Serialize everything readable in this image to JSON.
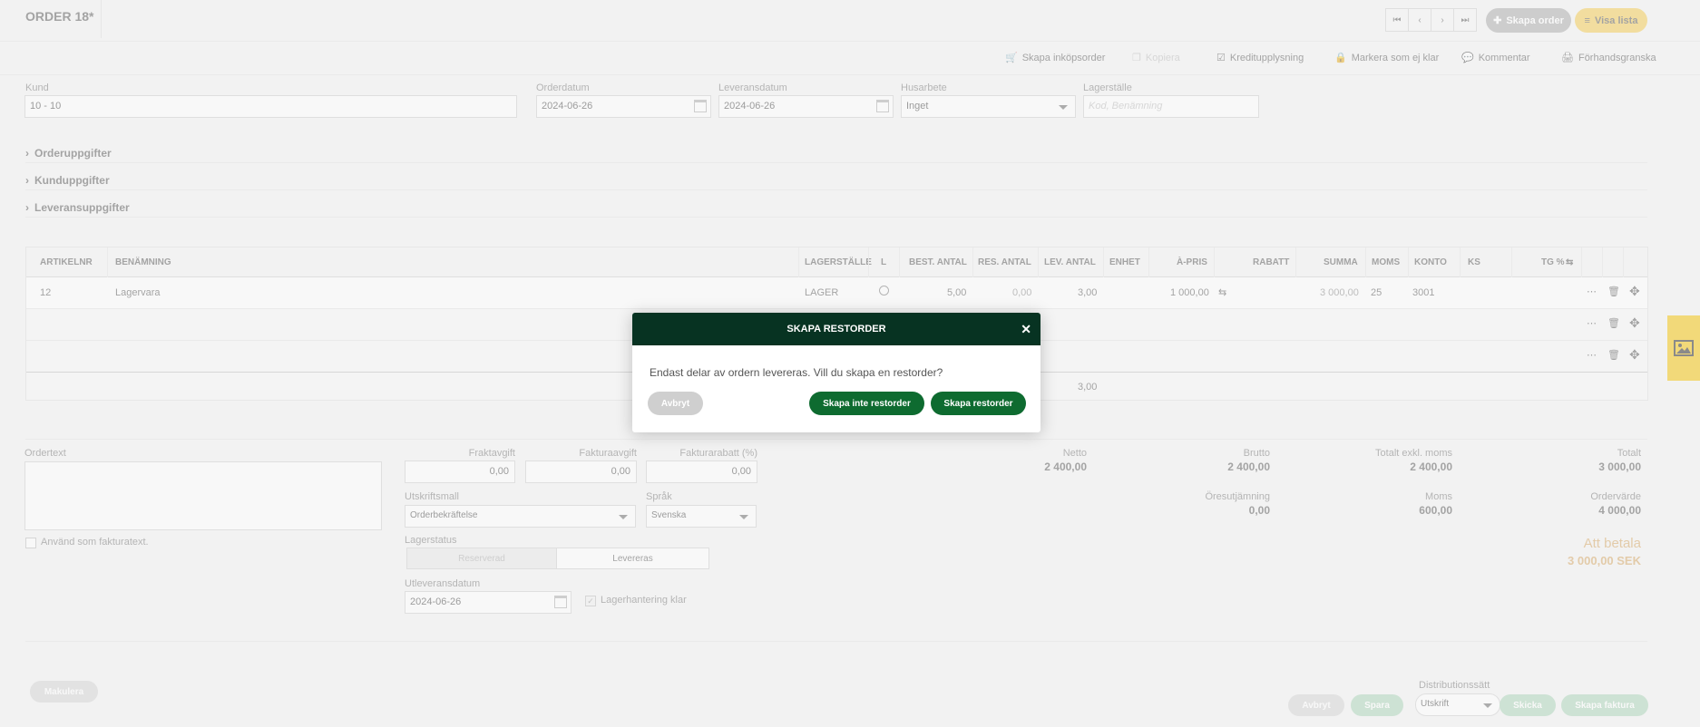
{
  "header": {
    "title": "ORDER 18*",
    "nav": [
      "⏮",
      "‹",
      "›",
      "⏭"
    ],
    "create_order_label": "Skapa order",
    "show_list_label": "Visa lista"
  },
  "toolbar": {
    "items": [
      {
        "label": "Skapa inköpsorder",
        "icon": "cart-icon",
        "disabled": false
      },
      {
        "label": "Kopiera",
        "icon": "copy-icon",
        "disabled": true
      },
      {
        "label": "Kreditupplysning",
        "icon": "check-square-icon",
        "disabled": false
      },
      {
        "label": "Markera som ej klar",
        "icon": "lock-icon",
        "disabled": false
      },
      {
        "label": "Kommentar",
        "icon": "comment-icon",
        "disabled": false
      },
      {
        "label": "Förhandsgranska",
        "icon": "print-icon",
        "disabled": false
      }
    ]
  },
  "form": {
    "customer_label": "Kund",
    "customer_value": "10 - 10",
    "order_date_label": "Orderdatum",
    "order_date_value": "2024-06-26",
    "delivery_date_label": "Leveransdatum",
    "delivery_date_value": "2024-06-26",
    "household_label": "Husarbete",
    "household_value": "Inget",
    "warehouse_label": "Lagerställe",
    "warehouse_placeholder": "Kod, Benämning"
  },
  "sections": [
    "Orderuppgifter",
    "Kunduppgifter",
    "Leveransuppgifter"
  ],
  "table": {
    "headers": [
      "ARTIKELNR",
      "BENÄMNING",
      "LAGERSTÄLLE",
      "L",
      "BEST. ANTAL",
      "RES. ANTAL",
      "LEV. ANTAL",
      "ENHET",
      "À-PRIS",
      "RABATT",
      "SUMMA",
      "MOMS",
      "KONTO",
      "KS",
      "TG %"
    ],
    "rows": [
      {
        "artikelnr": "12",
        "benamning": "Lagervara",
        "lagerstalle": "LAGER",
        "best_antal": "5,00",
        "res_antal": "0,00",
        "lev_antal": "3,00",
        "a_pris": "1 000,00",
        "summa": "3 000,00",
        "moms": "25",
        "konto": "3001"
      }
    ],
    "total_lev_antal": "3,00"
  },
  "bottom": {
    "ordertext_label": "Ordertext",
    "use_as_invoice_text": "Använd som fakturatext.",
    "freight_label": "Fraktavgift",
    "freight_value": "0,00",
    "invoice_fee_label": "Fakturaavgift",
    "invoice_fee_value": "0,00",
    "invoice_discount_label": "Fakturarabatt (%)",
    "invoice_discount_value": "0,00",
    "print_template_label": "Utskriftsmall",
    "print_template_value": "Orderbekräftelse",
    "language_label": "Språk",
    "language_value": "Svenska",
    "stock_status_label": "Lagerstatus",
    "stock_status_reserved": "Reserverad",
    "stock_status_deliver": "Levereras",
    "delivery_out_label": "Utleveransdatum",
    "delivery_out_value": "2024-06-26",
    "stock_handling_label": "Lagerhantering klar"
  },
  "summary": {
    "netto_label": "Netto",
    "netto_value": "2 400,00",
    "brutto_label": "Brutto",
    "brutto_value": "2 400,00",
    "excl_vat_label": "Totalt exkl. moms",
    "excl_vat_value": "2 400,00",
    "total_label": "Totalt",
    "total_value": "3 000,00",
    "rounding_label": "Öresutjämning",
    "rounding_value": "0,00",
    "vat_label": "Moms",
    "vat_value": "600,00",
    "order_value_label": "Ordervärde",
    "order_value_value": "4 000,00",
    "to_pay_label": "Att betala",
    "to_pay_value": "3 000,00 SEK"
  },
  "footer": {
    "void_label": "Makulera",
    "cancel_label": "Avbryt",
    "save_label": "Spara",
    "distribution_label": "Distributionssätt",
    "distribution_value": "Utskrift",
    "send_label": "Skicka",
    "create_invoice_label": "Skapa faktura"
  },
  "modal": {
    "title": "SKAPA RESTORDER",
    "message": "Endast delar av ordern levereras. Vill du skapa en restorder?",
    "cancel_label": "Avbryt",
    "no_backorder_label": "Skapa inte restorder",
    "backorder_label": "Skapa restorder"
  },
  "colors": {
    "modal_header": "#073322",
    "primary_green": "#0e6b30",
    "accent_yellow": "#f2c94c",
    "to_pay": "#d4a460"
  }
}
